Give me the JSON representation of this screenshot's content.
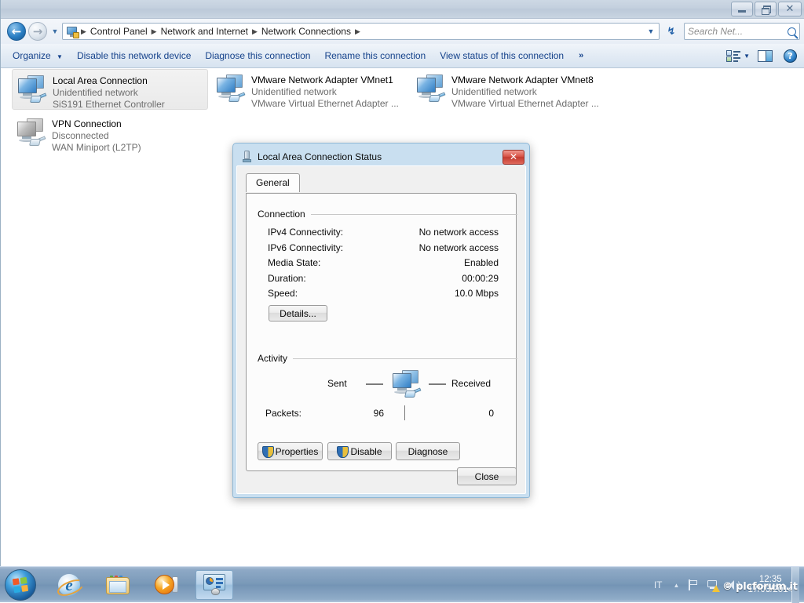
{
  "window": {
    "title_buttons": {
      "minimize": "−",
      "restore": "❐",
      "close": "✕"
    }
  },
  "address_bar": {
    "back_glyph": "←",
    "forward_glyph": "→",
    "history_caret": "▼",
    "icon": "control-panel-icon",
    "breadcrumbs": [
      "Control Panel",
      "Network and Internet",
      "Network Connections"
    ],
    "separator": "▶",
    "dropdown_caret": "▼",
    "refresh_glyph": "↯",
    "search_placeholder": "Search Net...",
    "search_value": ""
  },
  "command_bar": {
    "organize": "Organize",
    "organize_caret": "▼",
    "items": [
      "Disable this network device",
      "Diagnose this connection",
      "Rename this connection",
      "View status of this connection"
    ],
    "overflow": "»",
    "views_caret": "▼"
  },
  "connections": [
    {
      "name": "Local Area Connection",
      "status": "Unidentified network",
      "device": "SiS191 Ethernet Controller",
      "selected": true,
      "disabled": false
    },
    {
      "name": "VMware Network Adapter VMnet1",
      "status": "Unidentified network",
      "device": "VMware Virtual Ethernet Adapter ...",
      "selected": false,
      "disabled": false
    },
    {
      "name": "VMware Network Adapter VMnet8",
      "status": "Unidentified network",
      "device": "VMware Virtual Ethernet Adapter ...",
      "selected": false,
      "disabled": false
    },
    {
      "name": "VPN Connection",
      "status": "Disconnected",
      "device": "WAN Miniport (L2TP)",
      "selected": false,
      "disabled": true
    }
  ],
  "dialog": {
    "title": "Local Area Connection Status",
    "close_glyph": "✕",
    "tab": "General",
    "connection_group": "Connection",
    "connection_rows": [
      {
        "label": "IPv4 Connectivity:",
        "value": "No network access"
      },
      {
        "label": "IPv6 Connectivity:",
        "value": "No network access"
      },
      {
        "label": "Media State:",
        "value": "Enabled"
      },
      {
        "label": "Duration:",
        "value": "00:00:29"
      },
      {
        "label": "Speed:",
        "value": "10.0 Mbps"
      }
    ],
    "details_button": "Details...",
    "activity_group": "Activity",
    "sent_label": "Sent",
    "received_label": "Received",
    "packets_label": "Packets:",
    "packets_sent": "96",
    "packets_received": "0",
    "properties_button": "Properties",
    "disable_button": "Disable",
    "diagnose_button": "Diagnose",
    "close_button": "Close"
  },
  "taskbar": {
    "start": "start-orb",
    "items": [
      {
        "icon": "internet-explorer-icon",
        "active": false
      },
      {
        "icon": "windows-explorer-icon",
        "active": false
      },
      {
        "icon": "windows-media-player-icon",
        "active": false
      },
      {
        "icon": "network-connections-icon",
        "active": true
      }
    ],
    "tray": {
      "language": "IT",
      "show_hidden": "▲",
      "icons": [
        "flag-action-center-icon",
        "network-warning-icon",
        "volume-icon"
      ],
      "time": "12:35",
      "date": "17/03/2014"
    },
    "watermark": "© plcforum.it"
  }
}
